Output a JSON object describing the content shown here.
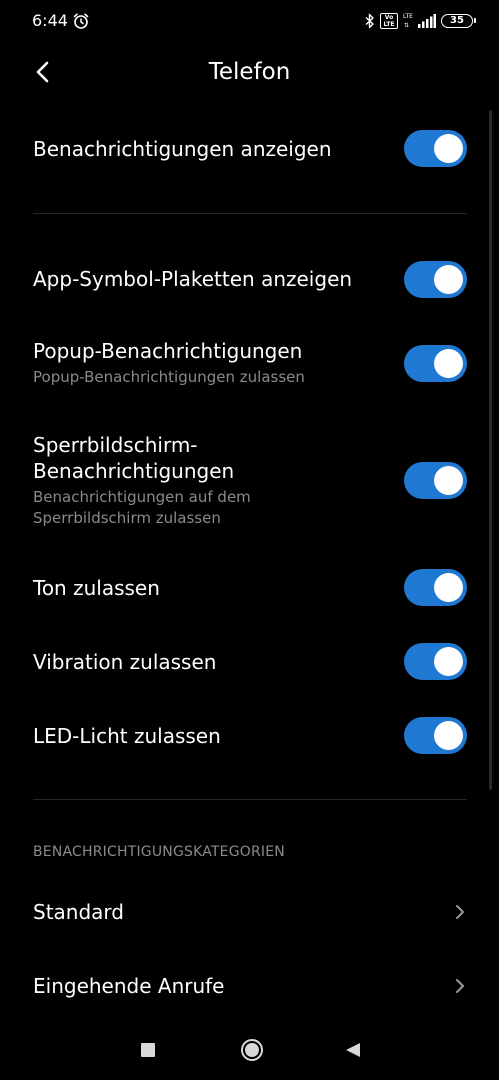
{
  "status_bar": {
    "time": "6:44",
    "icons": [
      "alarm-icon",
      "bluetooth-icon",
      "volte-icon",
      "lte-icon",
      "signal-icon",
      "battery-icon"
    ],
    "volte_label": "Vo LTE",
    "lte_label": "LTE",
    "battery_level": "35"
  },
  "header": {
    "title": "Telefon",
    "back_icon": "back-arrow-icon"
  },
  "settings": {
    "show_notifications": {
      "label": "Benachrichtigungen anzeigen",
      "enabled": true
    },
    "badges": {
      "label": "App-Symbol-Plaketten anzeigen",
      "enabled": true
    },
    "popup": {
      "label": "Popup-Benachrichtigungen",
      "sublabel": "Popup-Benachrichtigungen zulassen",
      "enabled": true
    },
    "lockscreen": {
      "label_line1": "Sperrbildschirm-",
      "label_line2": "Benachrichtigungen",
      "sublabel_line1": "Benachrichtigungen auf dem",
      "sublabel_line2": "Sperrbildschirm zulassen",
      "enabled": true
    },
    "sound": {
      "label": "Ton zulassen",
      "enabled": true
    },
    "vibration": {
      "label": "Vibration zulassen",
      "enabled": true
    },
    "led": {
      "label": "LED-Licht zulassen",
      "enabled": true
    }
  },
  "categories": {
    "header": "BENACHRICHTIGUNGSKATEGORIEN",
    "items": [
      {
        "label": "Standard"
      },
      {
        "label": "Eingehende Anrufe"
      }
    ]
  },
  "colors": {
    "background": "#000000",
    "toggle_on": "#1f78d1",
    "secondary_text": "#8a8a8a"
  },
  "nav_bar": {
    "icons": [
      "recents-square-icon",
      "home-circle-icon",
      "back-triangle-icon"
    ]
  }
}
